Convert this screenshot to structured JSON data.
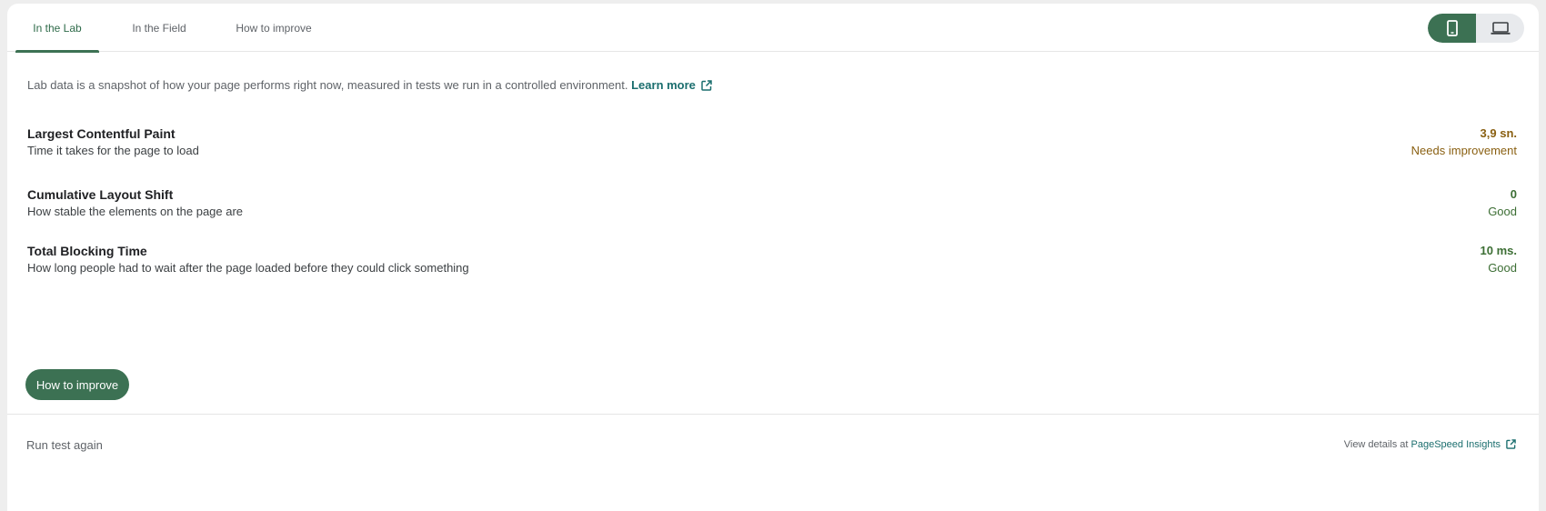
{
  "tabs": [
    {
      "label": "In the Lab",
      "active": true
    },
    {
      "label": "In the Field",
      "active": false
    },
    {
      "label": "How to improve",
      "active": false
    }
  ],
  "device_toggle": {
    "selected": "mobile",
    "options": [
      "mobile-icon",
      "laptop-icon"
    ]
  },
  "intro": {
    "text": "Lab data is a snapshot of how your page performs right now, measured in tests we run in a controlled environment.",
    "link_label": "Learn more"
  },
  "metrics": [
    {
      "title": "Largest Contentful Paint",
      "description": "Time it takes for the page to load",
      "value": "3,9 sn.",
      "status": "Needs improvement",
      "color": "#8a6012"
    },
    {
      "title": "Cumulative Layout Shift",
      "description": "How stable the elements on the page are",
      "value": "0",
      "status": "Good",
      "color": "#3c6e34"
    },
    {
      "title": "Total Blocking Time",
      "description": "How long people had to wait after the page loaded before they could click something",
      "value": "10 ms.",
      "status": "Good",
      "color": "#3c6e34"
    }
  ],
  "improve_button": "How to improve",
  "footer": {
    "run_again": "Run test again",
    "view_details_prefix": "View details at",
    "view_details_link": "PageSpeed Insights"
  },
  "colors": {
    "accent": "#3c7153",
    "link": "#1b6e6e",
    "needs_improvement": "#8a6012",
    "good": "#3c6e34"
  }
}
